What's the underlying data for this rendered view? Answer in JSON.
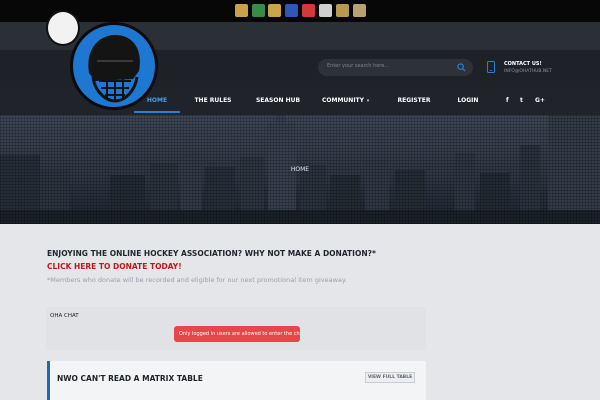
{
  "top_bar": {
    "team_logos": [
      {
        "icon": "team-logo-crown-icon",
        "color": "#caa04b"
      },
      {
        "icon": "team-logo-figure-icon",
        "color": "#3a8a4a"
      },
      {
        "icon": "team-logo-wing-icon",
        "color": "#c9a647"
      },
      {
        "icon": "team-logo-jet-icon",
        "color": "#2e57b8"
      },
      {
        "icon": "team-logo-red-icon",
        "color": "#d23a3a"
      },
      {
        "icon": "team-logo-letters-icon",
        "color": "#d0d0d0"
      },
      {
        "icon": "team-logo-knight-icon",
        "color": "#b89a4e"
      },
      {
        "icon": "team-logo-shield-icon",
        "color": "#b8a070"
      }
    ]
  },
  "header": {
    "search_placeholder": "Enter your search here...",
    "contact_title": "CONTACT US!",
    "contact_email": "INFO@OHATHUB.NET"
  },
  "nav": {
    "items": [
      {
        "label": "HOME",
        "active": true
      },
      {
        "label": "THE RULES"
      },
      {
        "label": "SEASON HUB"
      },
      {
        "label": "COMMUNITY"
      },
      {
        "label": "REGISTER"
      },
      {
        "label": "LOGIN"
      }
    ],
    "community_caret": "▾",
    "social": [
      "f",
      "t",
      "G+"
    ]
  },
  "hero": {
    "breadcrumb": "HOME"
  },
  "donation": {
    "question": "ENJOYING THE ONLINE HOCKEY ASSOCIATION? WHY NOT MAKE A DONATION?*",
    "link": "CLICK HERE TO DONATE TODAY!",
    "note": "*Members who donate will be recorded and eligible for our next promotional item giveaway."
  },
  "chat": {
    "title": "OHA CHAT",
    "alert": "Only logged in users are allowed to enter the chat"
  },
  "card": {
    "title": "NWO CAN'T READ A MATRIX TABLE",
    "button": "VIEW FULL TABLE"
  },
  "colors": {
    "accent": "#2a7ed4",
    "donate_link": "#c2161c",
    "alert": "#e8464a",
    "logo_blue": "#1e78d2"
  }
}
